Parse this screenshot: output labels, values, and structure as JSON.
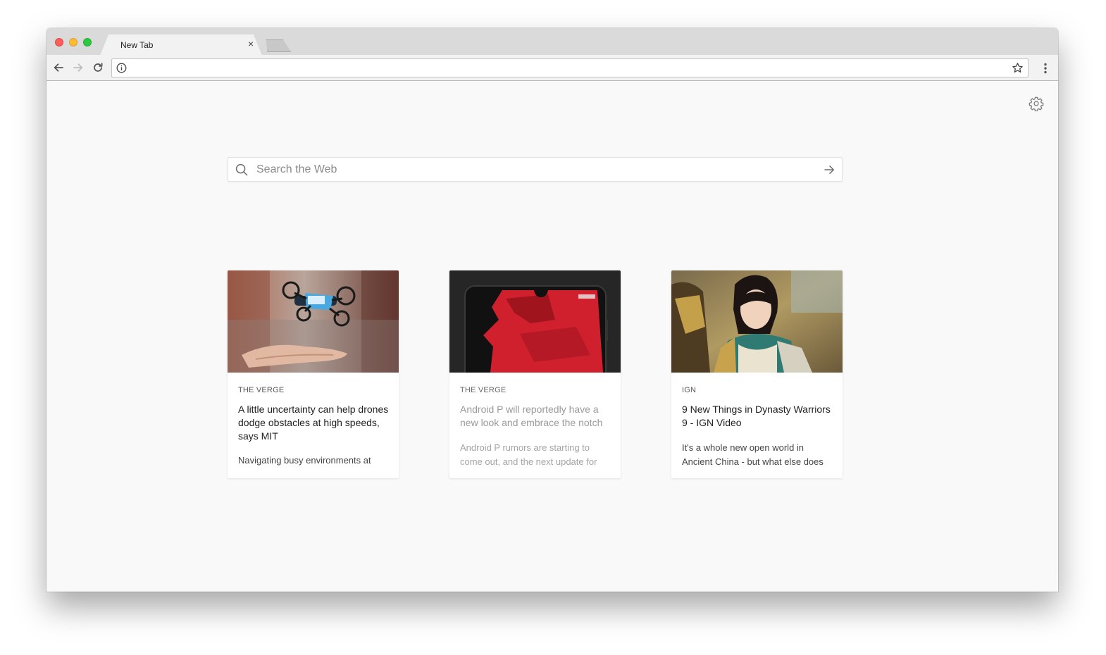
{
  "browser": {
    "tab_title": "New Tab",
    "tab_close": "×",
    "url": ""
  },
  "search": {
    "placeholder": "Search the Web"
  },
  "cards": [
    {
      "source": "THE VERGE",
      "title": "A little uncertainty can help drones dodge obstacles at high speeds, says MIT",
      "description": "Navigating busy environments at"
    },
    {
      "source": "THE VERGE",
      "title": "Android P will reportedly have a new look and embrace the notch",
      "description": "Android P rumors are starting to come out, and the next update for"
    },
    {
      "source": "IGN",
      "title": "9 New Things in Dynasty Warriors 9 - IGN Video",
      "description": "It's a whole new open world in Ancient China - but what else does"
    }
  ],
  "icons": {
    "back": "arrow-left-icon",
    "forward": "arrow-right-icon",
    "reload": "reload-icon",
    "info": "info-icon",
    "star": "star-icon",
    "menu": "kebab-menu-icon",
    "settings": "gear-icon",
    "search": "search-icon",
    "go": "arrow-right-icon"
  },
  "colors": {
    "close_red": "#fc5f57",
    "minimize_yellow": "#fdbb2e",
    "zoom_green": "#2bc840",
    "page_background": "#f9f9f9"
  }
}
